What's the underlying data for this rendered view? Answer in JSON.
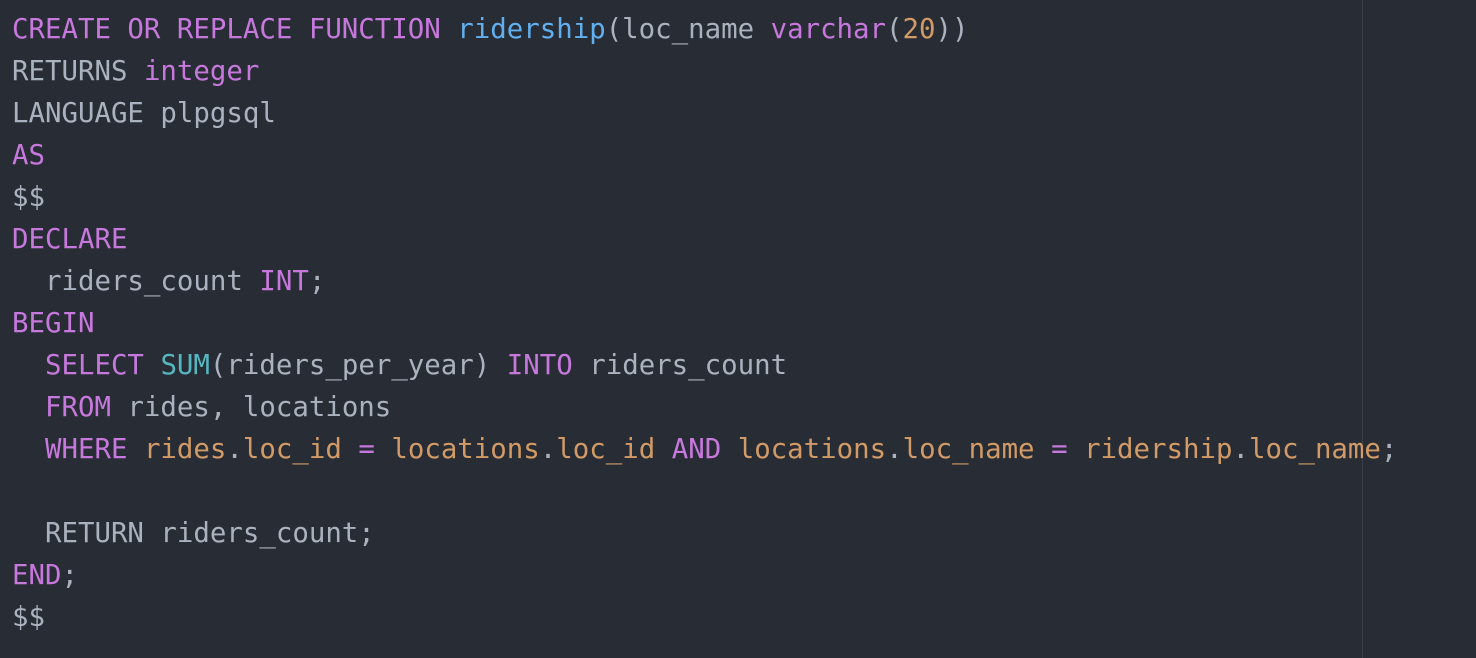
{
  "editor": {
    "language": "plpgsql",
    "colors": {
      "background": "#282c34",
      "default_text": "#abb2bf",
      "keyword": "#c678dd",
      "function_name": "#61afef",
      "builtin": "#56b6c2",
      "number_and_identifier": "#d19a66",
      "ruler": "#3b4048"
    },
    "lines": [
      [
        {
          "t": "CREATE OR REPLACE FUNCTION",
          "c": "kw"
        },
        {
          "t": " ",
          "c": "txt"
        },
        {
          "t": "ridership",
          "c": "fn"
        },
        {
          "t": "(loc_name ",
          "c": "txt"
        },
        {
          "t": "varchar",
          "c": "kw"
        },
        {
          "t": "(",
          "c": "txt"
        },
        {
          "t": "20",
          "c": "num"
        },
        {
          "t": "))",
          "c": "txt"
        }
      ],
      [
        {
          "t": "RETURNS ",
          "c": "txt"
        },
        {
          "t": "integer",
          "c": "kw"
        }
      ],
      [
        {
          "t": "LANGUAGE plpgsql",
          "c": "txt"
        }
      ],
      [
        {
          "t": "AS",
          "c": "kw"
        }
      ],
      [
        {
          "t": "$$",
          "c": "txt"
        }
      ],
      [
        {
          "t": "DECLARE",
          "c": "kw"
        }
      ],
      [
        {
          "t": "  riders_count ",
          "c": "txt"
        },
        {
          "t": "INT",
          "c": "kw"
        },
        {
          "t": ";",
          "c": "txt"
        }
      ],
      [
        {
          "t": "BEGIN",
          "c": "kw"
        }
      ],
      [
        {
          "t": "  ",
          "c": "txt"
        },
        {
          "t": "SELECT",
          "c": "kw"
        },
        {
          "t": " ",
          "c": "txt"
        },
        {
          "t": "SUM",
          "c": "bi"
        },
        {
          "t": "(riders_per_year) ",
          "c": "txt"
        },
        {
          "t": "INTO",
          "c": "kw"
        },
        {
          "t": " riders_count",
          "c": "txt"
        }
      ],
      [
        {
          "t": "  ",
          "c": "txt"
        },
        {
          "t": "FROM",
          "c": "kw"
        },
        {
          "t": " rides, locations",
          "c": "txt"
        }
      ],
      [
        {
          "t": "  ",
          "c": "txt"
        },
        {
          "t": "WHERE",
          "c": "kw"
        },
        {
          "t": " ",
          "c": "txt"
        },
        {
          "t": "rides",
          "c": "id"
        },
        {
          "t": ".",
          "c": "txt"
        },
        {
          "t": "loc_id",
          "c": "id"
        },
        {
          "t": " ",
          "c": "txt"
        },
        {
          "t": "=",
          "c": "op"
        },
        {
          "t": " ",
          "c": "txt"
        },
        {
          "t": "locations",
          "c": "id"
        },
        {
          "t": ".",
          "c": "txt"
        },
        {
          "t": "loc_id",
          "c": "id"
        },
        {
          "t": " ",
          "c": "txt"
        },
        {
          "t": "AND",
          "c": "kw"
        },
        {
          "t": " ",
          "c": "txt"
        },
        {
          "t": "locations",
          "c": "id"
        },
        {
          "t": ".",
          "c": "txt"
        },
        {
          "t": "loc_name",
          "c": "id"
        },
        {
          "t": " ",
          "c": "txt"
        },
        {
          "t": "=",
          "c": "op"
        },
        {
          "t": " ",
          "c": "txt"
        },
        {
          "t": "ridership",
          "c": "id"
        },
        {
          "t": ".",
          "c": "txt"
        },
        {
          "t": "loc_name",
          "c": "id"
        },
        {
          "t": ";",
          "c": "txt"
        }
      ],
      [],
      [
        {
          "t": "  RETURN riders_count;",
          "c": "txt"
        }
      ],
      [
        {
          "t": "END",
          "c": "kw"
        },
        {
          "t": ";",
          "c": "txt"
        }
      ],
      [
        {
          "t": "$$",
          "c": "txt"
        }
      ]
    ]
  }
}
